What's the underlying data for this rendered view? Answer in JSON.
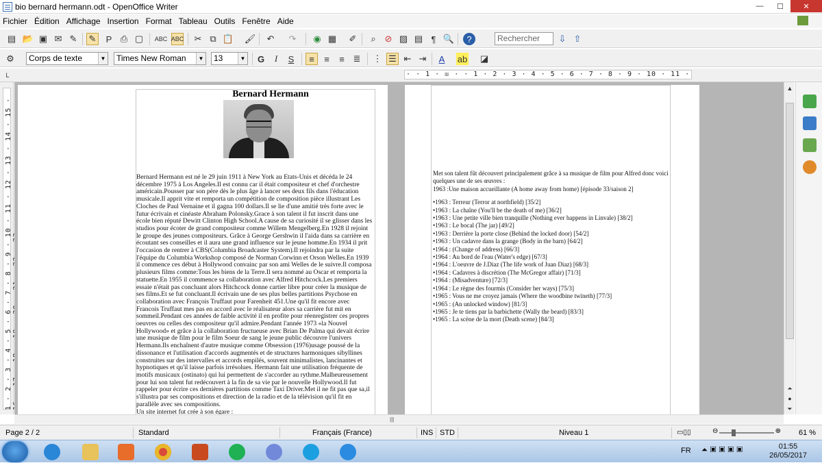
{
  "window": {
    "title": "bio bernard hermann.odt - OpenOffice Writer",
    "min": "—",
    "max": "☐",
    "close": "✕"
  },
  "menu": [
    "Fichier",
    "Édition",
    "Affichage",
    "Insertion",
    "Format",
    "Tableau",
    "Outils",
    "Fenêtre",
    "Aide"
  ],
  "toolbar": {
    "search_placeholder": "Rechercher",
    "paragraph_style": "Corps de texte",
    "font_name": "Times New Roman",
    "font_size": "13",
    "bold": "G",
    "italic": "I",
    "underline": "S"
  },
  "ruler": {
    "horizontal": "· · 1 · ☒ · · 1 · 2 · 3 · 4 · 5 · 6 · 7 · 8 · 9 · 10 · 11 · 12 · 13 · 14 · 15 · 16 · 17 · 18 ·",
    "vertical": "1 · 2 · 3 · 4 · 5 · 6 · 7 · 8 · 9 · 10 · 11 · 12 · 13 · 14 · 15 · 16 · 17 · 18 · 19 · 20 · 21 · 22 · 23 ·"
  },
  "page1": {
    "heading": "Bernard Hermann",
    "bio": "Bernard Hermann est né le 29 juin 1911 à New York au Etats-Unis et décéda le 24 décembre 1975 à Los Angeles.Il est connu car il était compositeur et chef d'orchestre américain.Pousser par son père dès le plus âge à lancer ses deux fils dans l'éducation musicale.Il apprit vite et remporta un compétition de composition pièce illustrant Les Cloches de Paul Vernaine et il gagna 100 dollars.Il se lie d'une amitié très forte avec le futur écrivain et cinéaste Abraham Polonsky.Grace à son talent il fut inscrit dans une école bien réputé Dewitt Clinton High School.A cause de sa curiosité il se glisser dans les studios pour écoter de grand compositeur comme Willem Mengelberg.En 1928 il rejoint le groupe des jeunes compositeurs. Grâce à George Gershwin il l'aida dans sa carrière en écoutant ses conseilles et il aura une grand influence sur le jeune homme.En 1934 il prit l'occasion de rentrer à CBS(Columbia Broadcaster System).Il rejoindra par la suite l'équipe du Columbia Workshop composé de Norman Corwinn et Orson Welles.En 1939 il commence ces début à Hollywood convainc par son ami Welles de le suivre.Il composa plusieurs films comme:Tous les biens de la Terre.Il sera nommé au Oscar et remporta la statuette.En 1955 il commence sa collaboration avec Alfred Hitchcock.Les premiers essaie n'était pas concluant alors Hitchcock donne cartier libre pour créer la musique de ses films.Et se fut concluant.Il écrivain une de ses plus belles partitions Psychose en collaboration avec François Truffaut pour Farenheit 451.Une qu'il fit encore avec Francois Truffaut mes pas en accord avec le réalisateur alors sa carrière fut mit en sommeil.Pendant ces années de faible activité il en profite pour réenregistrer ces propres oeuvres ou celles des compositeur qu'il admire.Pendant l'année 1973 «la Nouvel Hollywood» et grâce à la collaboration fructueuse avec Brian De Palma qui devait écrire une musique de film pour le film Soeur de sang le jeune public découvre l'univers Hermann.Ils enchaînent d'autre musique comme Obsession (1976)usage poussé de la dissonance et l'utilisation d'accords augmentés et de structures harmoniques sibyllines construites sur des intervalles et accords empilés, souvent minimalistes, lancinantes et hypnotiques et qu'il laisse parfois irrésolues. Hermann fait une utilisation fréquente de motifs musicaux (ostinato) qui lui permettent de s'accorder au rythme.Malheureusement pour lui son talent fut redécouvert à la fin de sa vie par le nouvelle Hollywood.Il fut rappeler pour écrire ces dernières partitions comme Taxi Driver.Met il ne fit pas que sa,il s'illustra par ses compositions et direction de la radio et de la télévision qu'il fit en parallèle avec ses compositions.",
    "last_line": "Un site internet fut crée à son égare :"
  },
  "page2": {
    "intro": "Met son talent fût découvert principalement grâce à sa musique de film pour Alfred donc voici quelques une de ses œuvres :",
    "first": "1963 :Une maison accueillante (A home away from home) [épisode 33/saison 2]",
    "films": [
      "•1963 : Terreur (Terror at northfield) [35/2]",
      "•1963 : La chaîne (You'll be the death of me) [36/2]",
      "•1963 : Une petite ville bien tranquille (Nothing ever happens in Linvale) [38/2]",
      "•1963 : Le bocal (The jar) [49/2]",
      "•1963 : Derrière la porte close (Behind the locked door) [54/2]",
      "•1963 : Un cadavre dans la grange (Body in the barn) [64/2]",
      "•1964 : (Change of address) [66/3]",
      "•1964 : Au bord de l'eau (Water's edge) [67/3]",
      "•1964 : L'oeuvre de J.Diaz (The life work of Juan Diaz) [68/3]",
      "•1964 : Cadavres à discrétion (The McGregor affair) [71/3]",
      "•1964 : (Misadventure) [72/3]",
      "•1964 : Le règne des fourmis (Consider her ways) [75/3]",
      "•1965 : Vous ne me croyez jamais (Where the woodbine twineth) [77/3]",
      "•1965 : (An unlocked window) [81/3]",
      "•1965 : Je te tiens par la barbichette (Wally the beard) [83/3]",
      "•1965 : La scène de la mort (Death scene) [84/3]"
    ]
  },
  "status": {
    "page": "Page 2 / 2",
    "style": "Standard",
    "language": "Français (France)",
    "ins": "INS",
    "std": "STD",
    "level": "Niveau 1",
    "zoom": "61 %",
    "zoom_level": 0.61
  },
  "taskbar": {
    "lang": "FR",
    "time": "01:55",
    "date": "26/05/2017"
  },
  "colors": {
    "close": "#c7372f",
    "accent": "#3b6fb6",
    "taskbar": "#aac6e6"
  }
}
